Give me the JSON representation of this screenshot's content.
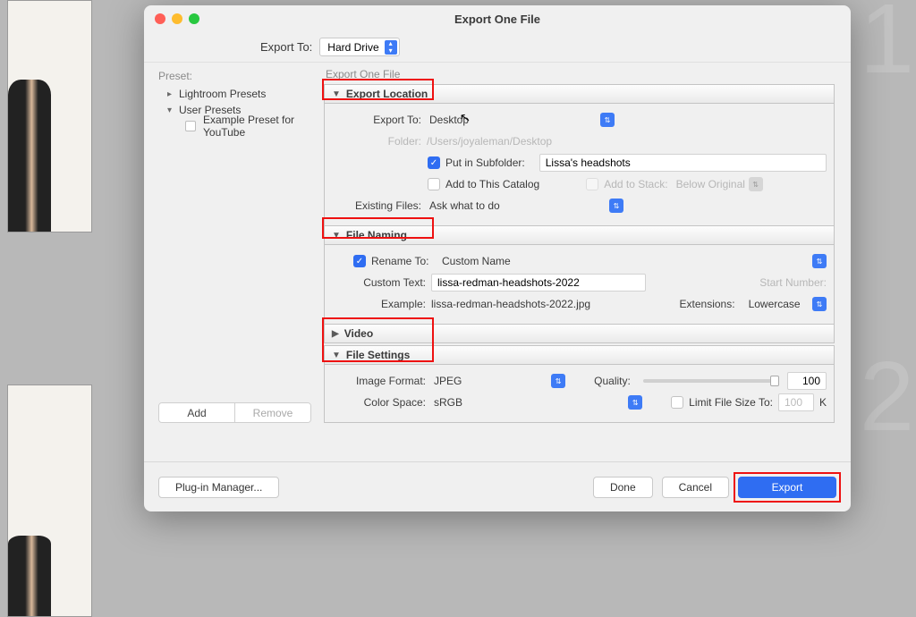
{
  "bg": {
    "num_top": "1",
    "num_bot": "2"
  },
  "dialog": {
    "title": "Export One File",
    "export_to_label": "Export To:",
    "export_to_value": "Hard Drive"
  },
  "presets": {
    "header": "Preset:",
    "group_lightroom": "Lightroom Presets",
    "group_user": "User Presets",
    "example_item": "Example Preset for YouTube",
    "add_btn": "Add",
    "remove_btn": "Remove"
  },
  "content": {
    "subtitle": "Export One File",
    "sec_location": "Export Location",
    "loc_exportto_label": "Export To:",
    "loc_exportto_value": "Desktop",
    "loc_folder_label": "Folder:",
    "loc_folder_value": "/Users/joyaleman/Desktop",
    "loc_subfolder_label": "Put in Subfolder:",
    "loc_subfolder_value": "Lissa's headshots",
    "loc_addcatalog_label": "Add to This Catalog",
    "loc_addstack_label": "Add to Stack:",
    "loc_addstack_value": "Below Original",
    "loc_existing_label": "Existing Files:",
    "loc_existing_value": "Ask what to do",
    "sec_naming": "File Naming",
    "nm_rename_label": "Rename To:",
    "nm_rename_value": "Custom Name",
    "nm_custom_label": "Custom Text:",
    "nm_custom_value": "lissa-redman-headshots-2022",
    "nm_startnum_label": "Start Number:",
    "nm_example_label": "Example:",
    "nm_example_value": "lissa-redman-headshots-2022.jpg",
    "nm_ext_label": "Extensions:",
    "nm_ext_value": "Lowercase",
    "sec_video": "Video",
    "sec_filesettings": "File Settings",
    "fs_format_label": "Image Format:",
    "fs_format_value": "JPEG",
    "fs_quality_label": "Quality:",
    "fs_quality_value": "100",
    "fs_colorspace_label": "Color Space:",
    "fs_colorspace_value": "sRGB",
    "fs_limit_label": "Limit File Size To:",
    "fs_limit_value": "100",
    "fs_limit_unit": "K"
  },
  "footer": {
    "plugin_btn": "Plug-in Manager...",
    "done_btn": "Done",
    "cancel_btn": "Cancel",
    "export_btn": "Export"
  }
}
